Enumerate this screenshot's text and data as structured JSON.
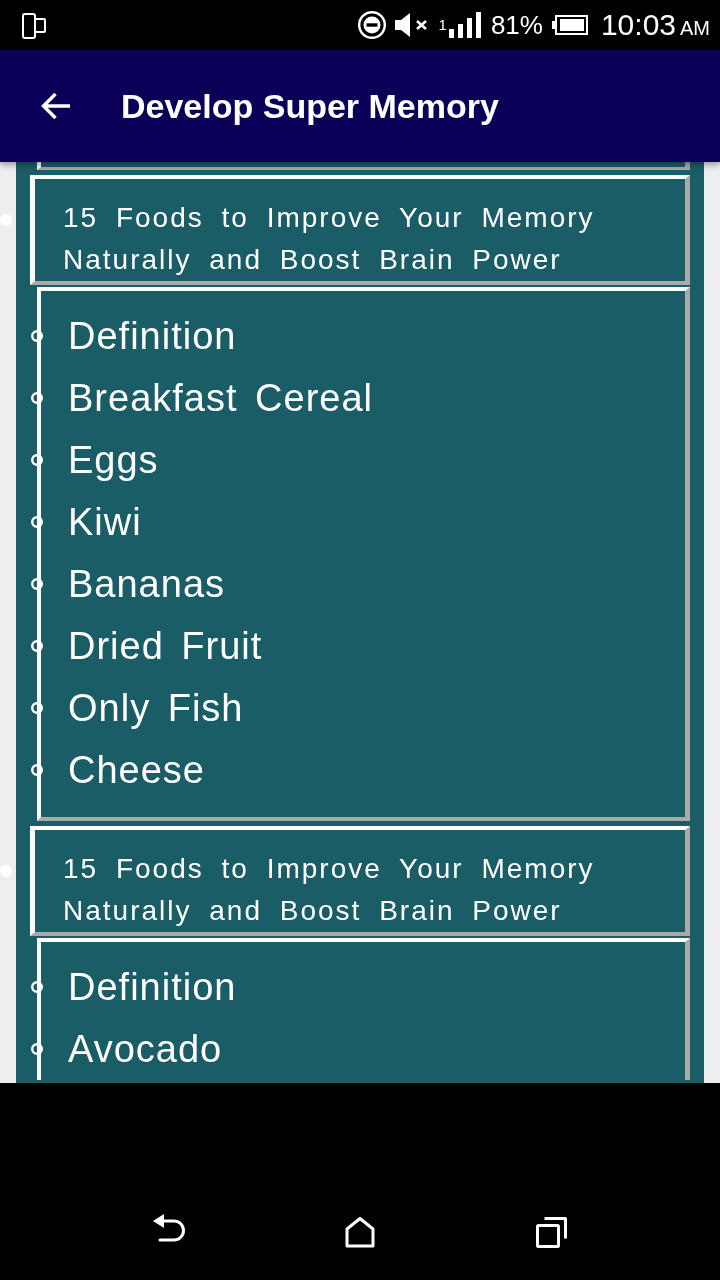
{
  "status_bar": {
    "sim_label": "1",
    "battery_percent": "81%",
    "time": "10:03",
    "meridiem": "AM"
  },
  "app_bar": {
    "title": "Develop Super Memory"
  },
  "sections": [
    {
      "heading": "15 Foods to Improve Your Memory Naturally and Boost Brain Power",
      "items": [
        "Definition",
        "Breakfast Cereal",
        "Eggs",
        "Kiwi",
        "Bananas",
        "Dried Fruit",
        "Only Fish",
        "Cheese"
      ]
    },
    {
      "heading": "15 Foods to Improve Your Memory Naturally and Boost Brain Power",
      "items": [
        "Definition",
        "Avocado"
      ]
    }
  ]
}
